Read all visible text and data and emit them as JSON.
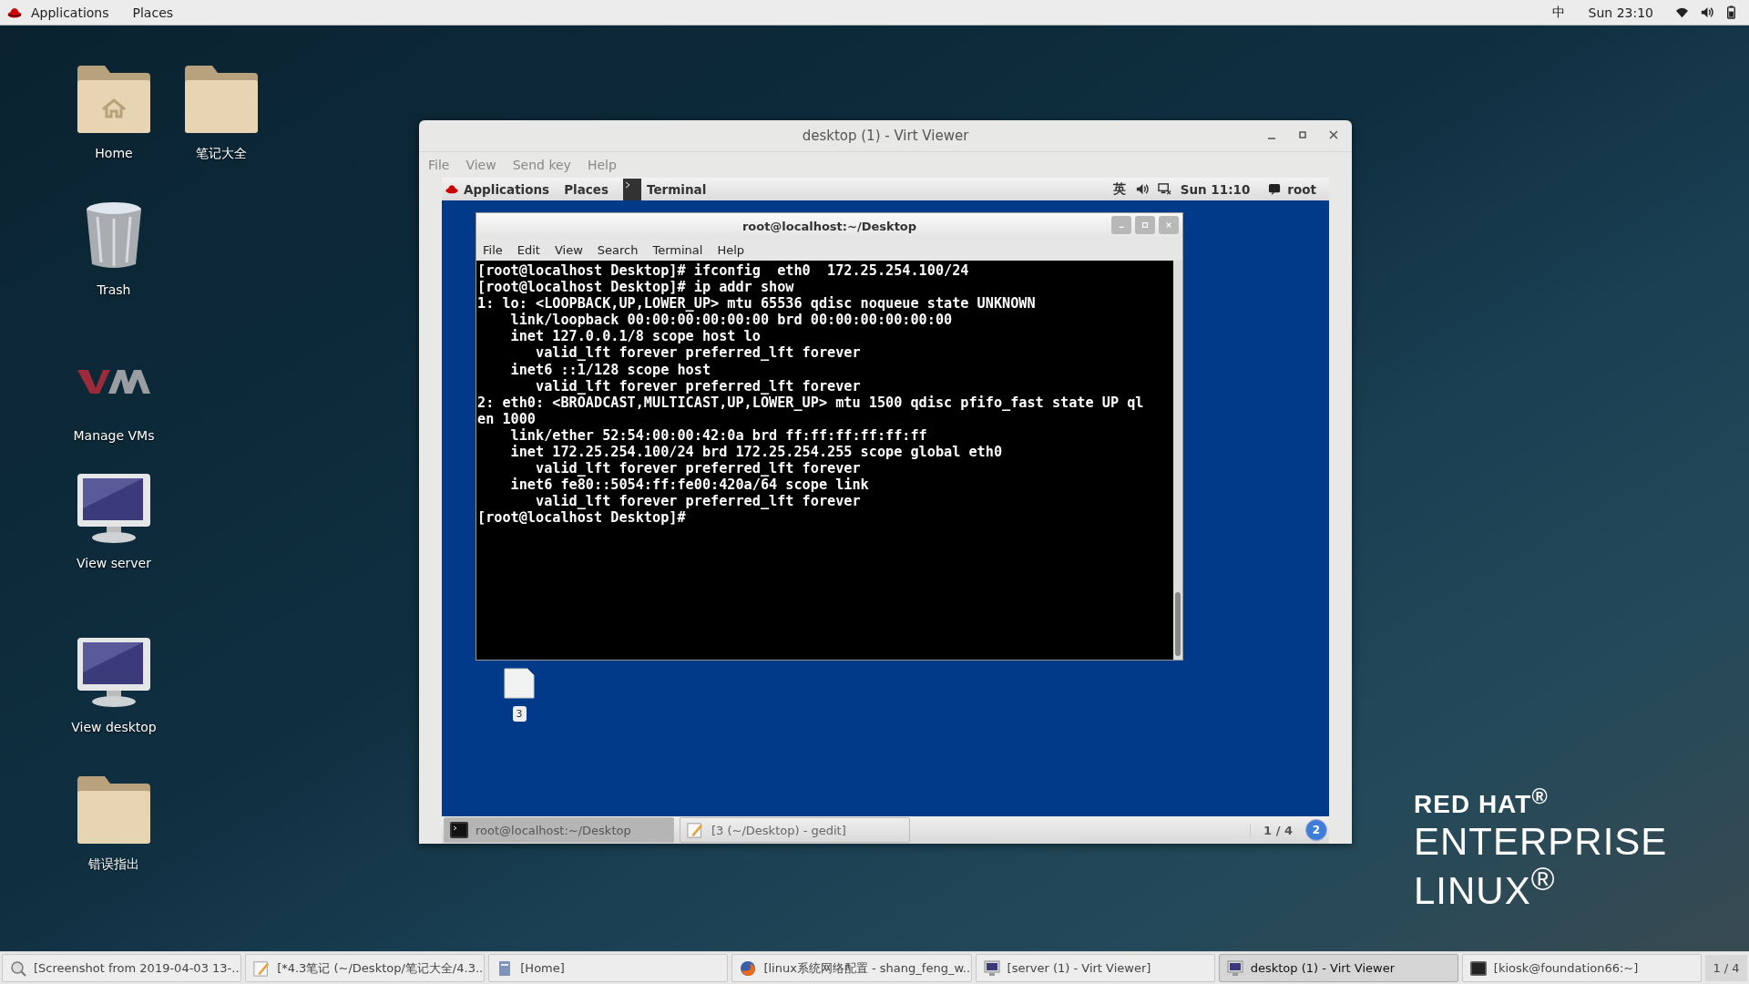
{
  "top_bar": {
    "menus": [
      "Applications",
      "Places"
    ],
    "input_method": "中",
    "clock": "Sun 23:10"
  },
  "desktop_icons": [
    {
      "label": "Home",
      "kind": "home"
    },
    {
      "label": "笔记大全",
      "kind": "folder"
    },
    {
      "label": "Trash",
      "kind": "trash"
    },
    {
      "label": "Manage VMs",
      "kind": "vm"
    },
    {
      "label": "View server",
      "kind": "monitor"
    },
    {
      "label": "View desktop",
      "kind": "monitor"
    },
    {
      "label": "错误指出",
      "kind": "folder"
    }
  ],
  "window": {
    "title": "desktop (1) - Virt Viewer",
    "menu": [
      "File",
      "View",
      "Send key",
      "Help"
    ],
    "guest": {
      "top_bar": {
        "menus": [
          "Applications",
          "Places"
        ],
        "active_app": "Terminal",
        "input_method": "英",
        "clock": "Sun 11:10",
        "user": "root"
      },
      "terminal": {
        "title": "root@localhost:~/Desktop",
        "menu": [
          "File",
          "Edit",
          "View",
          "Search",
          "Terminal",
          "Help"
        ],
        "lines": [
          "[root@localhost Desktop]# ifconfig  eth0  172.25.254.100/24",
          "[root@localhost Desktop]# ip addr show",
          "1: lo: <LOOPBACK,UP,LOWER_UP> mtu 65536 qdisc noqueue state UNKNOWN",
          "    link/loopback 00:00:00:00:00:00 brd 00:00:00:00:00:00",
          "    inet 127.0.0.1/8 scope host lo",
          "       valid_lft forever preferred_lft forever",
          "    inet6 ::1/128 scope host",
          "       valid_lft forever preferred_lft forever",
          "2: eth0: <BROADCAST,MULTICAST,UP,LOWER_UP> mtu 1500 qdisc pfifo_fast state UP ql",
          "en 1000",
          "    link/ether 52:54:00:00:42:0a brd ff:ff:ff:ff:ff:ff",
          "    inet 172.25.254.100/24 brd 172.25.254.255 scope global eth0",
          "       valid_lft forever preferred_lft forever",
          "    inet6 fe80::5054:ff:fe00:420a/64 scope link",
          "       valid_lft forever preferred_lft forever",
          "[root@localhost Desktop]#"
        ]
      },
      "desktop_file": {
        "label": "3"
      },
      "taskbar": {
        "items": [
          {
            "label": "root@localhost:~/Desktop",
            "kind": "terminal",
            "selected": true
          },
          {
            "label": "[3 (~/Desktop) - gedit]",
            "kind": "editor",
            "selected": false
          }
        ],
        "workspace": "1 / 4",
        "notifications": "2"
      }
    }
  },
  "brand": {
    "lines": [
      "RED HAT$^{®}$",
      "ENTERPRISE",
      "LINUX$^{®}$"
    ]
  },
  "taskbar": {
    "items": [
      {
        "label": "[Screenshot from 2019-04-03 13-...",
        "kind": "image",
        "selected": false
      },
      {
        "label": "[*4.3笔记 (~/Desktop/笔记大全/4.3...",
        "kind": "editor",
        "selected": false
      },
      {
        "label": "[Home]",
        "kind": "files",
        "selected": false
      },
      {
        "label": "[linux系统网络配置 - shang_feng_w...",
        "kind": "browser",
        "selected": false
      },
      {
        "label": "[server (1) - Virt Viewer]",
        "kind": "viewer",
        "selected": false
      },
      {
        "label": "desktop (1) - Virt Viewer",
        "kind": "viewer",
        "selected": true
      },
      {
        "label": "[kiosk@foundation66:~]",
        "kind": "terminal",
        "selected": false
      }
    ],
    "workspace": "1 / 4"
  }
}
